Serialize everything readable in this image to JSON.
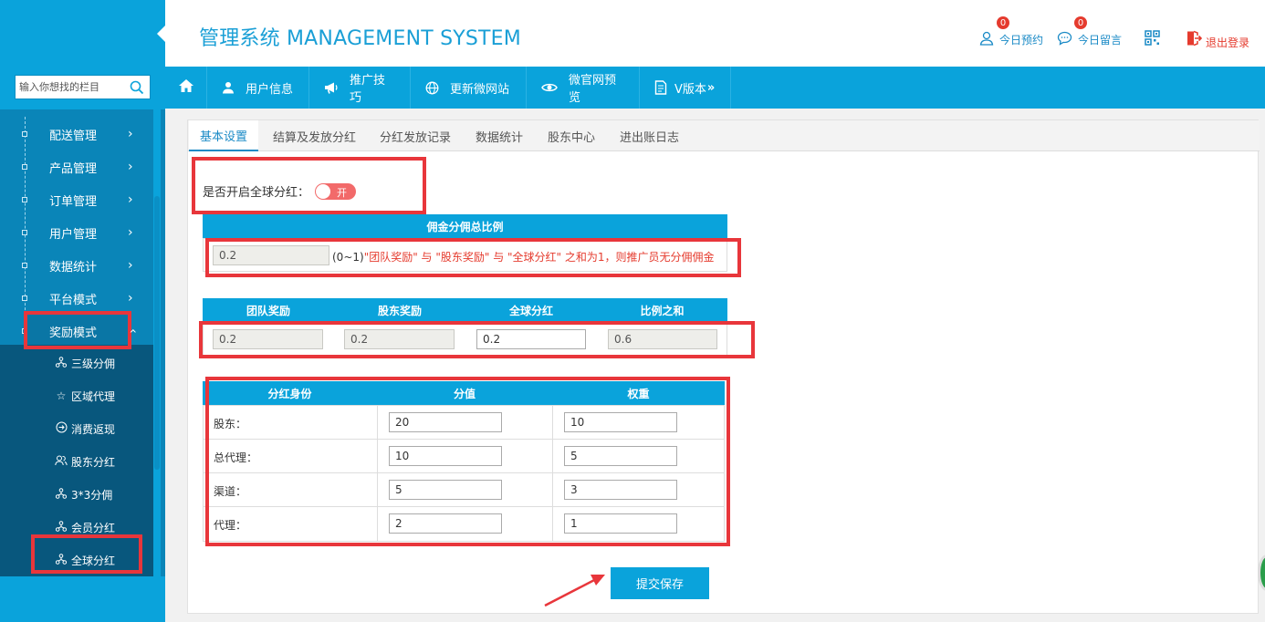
{
  "header": {
    "title": "管理系统 MANAGEMENT SYSTEM",
    "appointments": {
      "label": "今日预约",
      "count": "0"
    },
    "messages": {
      "label": "今日留言",
      "count": "0"
    },
    "logout": "退出登录"
  },
  "search": {
    "placeholder": "输入你想找的栏目"
  },
  "topnav": [
    {
      "label": "用户信息",
      "icon": "user-icon"
    },
    {
      "label": "推广技巧",
      "icon": "megaphone-icon"
    },
    {
      "label": "更新微网站",
      "icon": "globe-icon"
    },
    {
      "label": "微官网预览",
      "icon": "eye-icon"
    },
    {
      "label": "V版本",
      "icon": "document-icon"
    }
  ],
  "sidebar": {
    "items": [
      {
        "label": "配送管理"
      },
      {
        "label": "产品管理"
      },
      {
        "label": "订单管理"
      },
      {
        "label": "用户管理"
      },
      {
        "label": "数据统计"
      },
      {
        "label": "平台模式"
      },
      {
        "label": "奖励模式"
      }
    ],
    "sub_items": [
      {
        "label": "三级分佣",
        "icon": "network-icon"
      },
      {
        "label": "区域代理",
        "icon": "star-icon"
      },
      {
        "label": "消费返现",
        "icon": "arrow-circle-icon"
      },
      {
        "label": "股东分红",
        "icon": "users-icon"
      },
      {
        "label": "3*3分佣",
        "icon": "network-icon"
      },
      {
        "label": "会员分红",
        "icon": "network-icon"
      },
      {
        "label": "全球分红",
        "icon": "network-icon"
      }
    ]
  },
  "tabs": [
    {
      "label": "基本设置"
    },
    {
      "label": "结算及发放分红"
    },
    {
      "label": "分红发放记录"
    },
    {
      "label": "数据统计"
    },
    {
      "label": "股东中心"
    },
    {
      "label": "进出账日志"
    }
  ],
  "toggle": {
    "label": "是否开启全球分红：",
    "state": "开"
  },
  "commission": {
    "header": "佣金分佣总比例",
    "value": "0.2",
    "note_prefix": "(0~1)",
    "note_red": "\"团队奖励\" 与 \"股东奖励\" 与 \"全球分红\" 之和为1，则推广员无分佣佣金"
  },
  "ratios": {
    "headers": [
      "团队奖励",
      "股东奖励",
      "全球分红",
      "比例之和"
    ],
    "values": [
      "0.2",
      "0.2",
      "0.2",
      "0.6"
    ]
  },
  "dividend": {
    "headers": [
      "分红身份",
      "分值",
      "权重"
    ],
    "rows": [
      {
        "label": "股东：",
        "score": "20",
        "weight": "10"
      },
      {
        "label": "总代理：",
        "score": "10",
        "weight": "5"
      },
      {
        "label": "渠道：",
        "score": "5",
        "weight": "3"
      },
      {
        "label": "代理：",
        "score": "2",
        "weight": "1"
      }
    ]
  },
  "save_label": "提交保存",
  "colors": {
    "accent": "#0aa3db",
    "highlight": "#e8363b"
  }
}
